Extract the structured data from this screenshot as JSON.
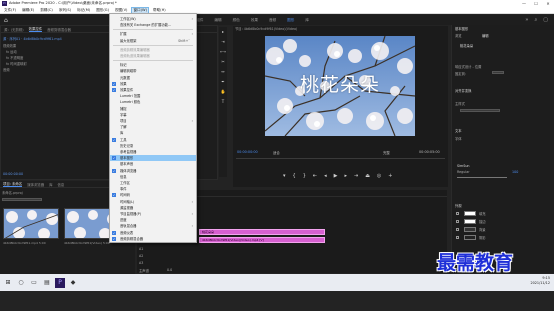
{
  "titlebar": {
    "app_badge": "Pr",
    "title": "Adobe Premiere Pro 2020 - C:\\用户\\Video\\桌面\\未命名.prproj *"
  },
  "menubar": {
    "items": [
      "文件(F)",
      "编辑(E)",
      "剪辑(C)",
      "序列(S)",
      "标记(M)",
      "图形(G)",
      "视图(V)",
      "窗口(W)",
      "帮助(H)"
    ],
    "active_index": 7
  },
  "workspaces": {
    "items": [
      "学习",
      "组件",
      "编辑",
      "颜色",
      "效果",
      "音频",
      "图形",
      "库"
    ],
    "active_index": 6
  },
  "source_panel": {
    "tabs": [
      "源：(无剪辑)",
      "效果控件",
      "音频剪辑混合器"
    ],
    "rows": [
      "源 · 序列01 · 4b6d8b0c9cd9f61.mp4",
      "视频效果",
      "fx 运动",
      "fx 不透明度",
      "fx 时间重映射",
      "音频"
    ],
    "timecode": "00:00:00:00"
  },
  "window_menu": {
    "items": [
      {
        "label": "工作区(W)",
        "checked": false,
        "disabled": false,
        "arrow": true,
        "shortcut": ""
      },
      {
        "label": "查找有关 Exchange 的扩展功能...",
        "checked": false,
        "disabled": false,
        "arrow": false,
        "shortcut": ""
      },
      {
        "label": "扩展",
        "checked": false,
        "disabled": false,
        "arrow": true,
        "shortcut": ""
      },
      {
        "label": "最大化框架",
        "checked": false,
        "disabled": false,
        "arrow": false,
        "shortcut": "Shift+`"
      },
      {
        "label": "音频剪辑效果编辑器",
        "checked": false,
        "disabled": true,
        "arrow": false,
        "shortcut": ""
      },
      {
        "label": "音频轨道效果编辑器",
        "checked": false,
        "disabled": true,
        "arrow": false,
        "shortcut": ""
      },
      {
        "label": "标记",
        "checked": false,
        "disabled": false,
        "arrow": false,
        "shortcut": ""
      },
      {
        "label": "编辑到磁带",
        "checked": false,
        "disabled": false,
        "arrow": false,
        "shortcut": ""
      },
      {
        "label": "元数据",
        "checked": false,
        "disabled": false,
        "arrow": false,
        "shortcut": ""
      },
      {
        "label": "效果",
        "checked": true,
        "disabled": false,
        "arrow": false,
        "shortcut": ""
      },
      {
        "label": "效果控件",
        "checked": true,
        "disabled": false,
        "arrow": false,
        "shortcut": ""
      },
      {
        "label": "Lumetri 范围",
        "checked": false,
        "disabled": false,
        "arrow": false,
        "shortcut": ""
      },
      {
        "label": "Lumetri 颜色",
        "checked": false,
        "disabled": false,
        "arrow": false,
        "shortcut": ""
      },
      {
        "label": "捕捉",
        "checked": false,
        "disabled": false,
        "arrow": false,
        "shortcut": ""
      },
      {
        "label": "字幕",
        "checked": false,
        "disabled": false,
        "arrow": false,
        "shortcut": ""
      },
      {
        "label": "项目",
        "checked": false,
        "disabled": false,
        "arrow": true,
        "shortcut": ""
      },
      {
        "label": "了解",
        "checked": false,
        "disabled": false,
        "arrow": false,
        "shortcut": ""
      },
      {
        "label": "库",
        "checked": false,
        "disabled": false,
        "arrow": false,
        "shortcut": ""
      },
      {
        "label": "工具",
        "checked": true,
        "disabled": false,
        "arrow": false,
        "shortcut": ""
      },
      {
        "label": "历史记录",
        "checked": false,
        "disabled": false,
        "arrow": false,
        "shortcut": ""
      },
      {
        "label": "参考监视器",
        "checked": false,
        "disabled": false,
        "arrow": false,
        "shortcut": ""
      },
      {
        "label": "基本图形",
        "checked": true,
        "disabled": false,
        "arrow": false,
        "shortcut": ""
      },
      {
        "label": "基本声音",
        "checked": false,
        "disabled": false,
        "arrow": false,
        "shortcut": ""
      },
      {
        "label": "媒体浏览器",
        "checked": true,
        "disabled": false,
        "arrow": false,
        "shortcut": ""
      },
      {
        "label": "信息",
        "checked": false,
        "disabled": false,
        "arrow": false,
        "shortcut": ""
      },
      {
        "label": "工作区",
        "checked": false,
        "disabled": false,
        "arrow": false,
        "shortcut": ""
      },
      {
        "label": "事件",
        "checked": false,
        "disabled": false,
        "arrow": false,
        "shortcut": ""
      },
      {
        "label": "时间码",
        "checked": true,
        "disabled": false,
        "arrow": false,
        "shortcut": ""
      },
      {
        "label": "时间轴(L)",
        "checked": false,
        "disabled": false,
        "arrow": true,
        "shortcut": ""
      },
      {
        "label": "源监视器",
        "checked": false,
        "disabled": false,
        "arrow": false,
        "shortcut": ""
      },
      {
        "label": "节目监视器(P)",
        "checked": false,
        "disabled": false,
        "arrow": true,
        "shortcut": ""
      },
      {
        "label": "进度",
        "checked": false,
        "disabled": false,
        "arrow": false,
        "shortcut": ""
      },
      {
        "label": "音轨混合器",
        "checked": false,
        "disabled": false,
        "arrow": true,
        "shortcut": ""
      },
      {
        "label": "音频仪表",
        "checked": true,
        "disabled": false,
        "arrow": false,
        "shortcut": ""
      },
      {
        "label": "音频剪辑混合器",
        "checked": true,
        "disabled": false,
        "arrow": false,
        "shortcut": ""
      }
    ],
    "highlighted_index": 21,
    "separators_after": [
      1,
      3,
      5
    ]
  },
  "program_monitor": {
    "title": "节目: 4b6d8b0c9cd9f61(Video)(Video)",
    "overlay_text": "桃花朵朵",
    "timecode_current": "00:00:00:00",
    "timecode_total": "00:00:05:00",
    "fit_label": "适合",
    "quality_label": "完整",
    "playback_icons": [
      "marker-icon",
      "in-point-icon",
      "out-point-icon",
      "step-back-icon",
      "play-icon",
      "step-forward-icon",
      "out-icon",
      "lift-icon",
      "extract-icon",
      "camera-icon",
      "add-button-icon"
    ]
  },
  "effects_panel": {
    "title": "基本图形",
    "tabs": [
      "浏览",
      "编辑"
    ],
    "layer_name": "桃花朵朵",
    "rows": [
      "响应式设计 - 位置",
      "固定到：",
      "对齐并变换",
      "主样式",
      "文本",
      "字体",
      "外观",
      "填充",
      "描边",
      "背景",
      "阴影",
      "蒙版"
    ],
    "font_value": "SimSun",
    "font_style": "Regular",
    "font_size": "100",
    "appearance_values": [
      "填充",
      "描边",
      "背景",
      "阴影"
    ]
  },
  "project_panel": {
    "tabs": [
      "项目: 未命名",
      "媒体浏览器",
      "库",
      "信息"
    ],
    "path": "未命名.prproj",
    "items": [
      {
        "caption": "4b6d8b0c9cd9f61.mp4  5:00"
      },
      {
        "caption": "4b6d8b0c9cd9f61(Video) 5:00"
      }
    ]
  },
  "timeline": {
    "tabs": [
      "4b6d8b0c9cd9f61(Video)"
    ],
    "timecode": "00:00:00:00",
    "tracks": [
      "V3",
      "V2",
      "V1",
      "A1",
      "A2",
      "A3",
      "主声道"
    ],
    "clips": [
      {
        "label": "桃花朵朵",
        "track": "V2"
      },
      {
        "label": "4b6d8b0c9cd9f61(Video)(Video).mp4 [V]",
        "track": "V1"
      }
    ],
    "master_value": "0.0"
  },
  "taskbar": {
    "time": "9:15",
    "date": "2021/11/12"
  },
  "watermark": "最需教育",
  "colors": {
    "accent": "#4c8df0",
    "clip": "#d660d0",
    "menu_highlight": "#90c8f6"
  }
}
